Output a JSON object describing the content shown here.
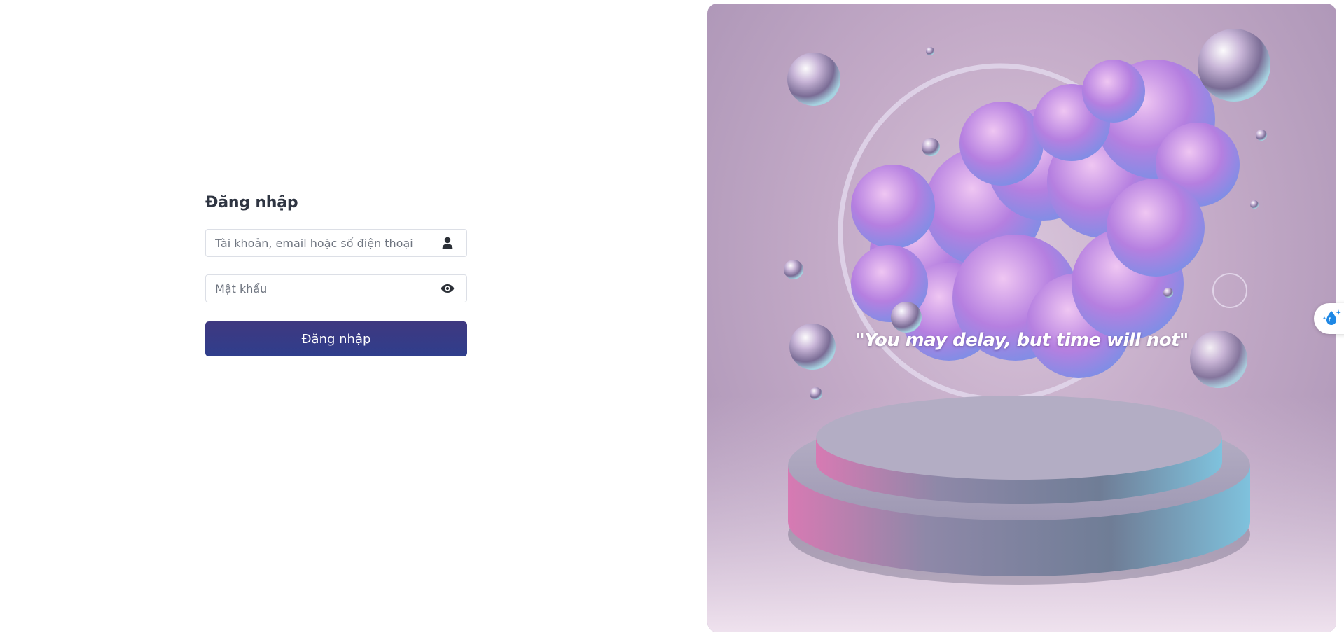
{
  "login": {
    "title": "Đăng nhập",
    "username": {
      "placeholder": "Tài khoản, email hoặc số điện thoại",
      "value": "",
      "icon": "user-icon"
    },
    "password": {
      "placeholder": "Mật khẩu",
      "value": "",
      "icon": "eye-icon"
    },
    "submit_label": "Đăng nhập",
    "button_color": "#3a3a84"
  },
  "hero": {
    "quote": "\"You may delay, but time will not\""
  },
  "side_widget": {
    "icon": "water-drop-sparkle-icon",
    "accent": "#1e88e5"
  }
}
